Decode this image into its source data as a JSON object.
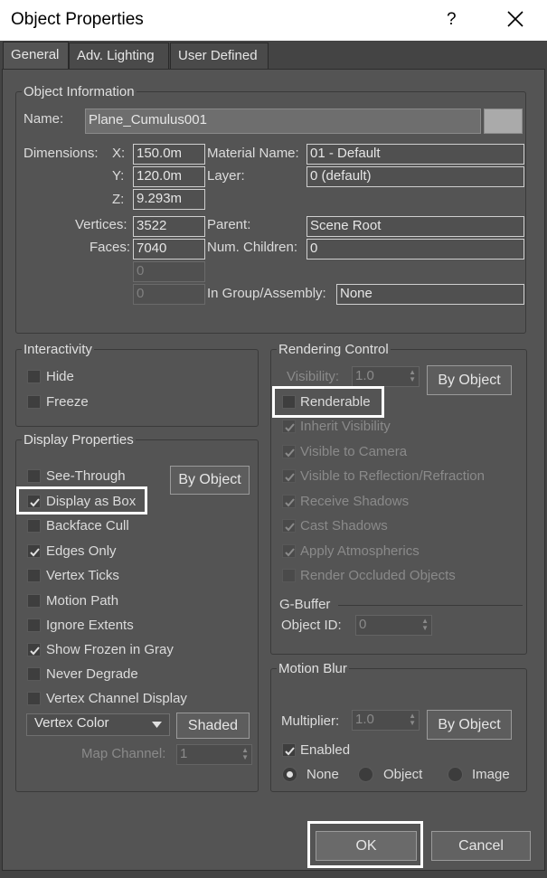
{
  "window": {
    "title": "Object Properties",
    "help": "?"
  },
  "tabs": [
    "General",
    "Adv. Lighting",
    "User Defined"
  ],
  "object_info": {
    "group": "Object Information",
    "name_label": "Name:",
    "name_value": "Plane_Cumulus001",
    "dimensions_label": "Dimensions:",
    "x_label": "X:",
    "x_value": "150.0m",
    "y_label": "Y:",
    "y_value": "120.0m",
    "z_label": "Z:",
    "z_value": "9.293m",
    "material_label": "Material Name:",
    "material_value": "01 - Default",
    "layer_label": "Layer:",
    "layer_value": "0 (default)",
    "vertices_label": "Vertices:",
    "vertices_value": "3522",
    "faces_label": "Faces:",
    "faces_value": "7040",
    "extra1_value": "0",
    "extra2_value": "0",
    "parent_label": "Parent:",
    "parent_value": "Scene Root",
    "children_label": "Num. Children:",
    "children_value": "0",
    "group_label": "In Group/Assembly:",
    "group_value": "None"
  },
  "interactivity": {
    "group": "Interactivity",
    "hide": "Hide",
    "freeze": "Freeze"
  },
  "display": {
    "group": "Display Properties",
    "by_object": "By Object",
    "items": [
      "See-Through",
      "Display as Box",
      "Backface Cull",
      "Edges Only",
      "Vertex Ticks",
      "Motion Path",
      "Ignore Extents",
      "Show Frozen in Gray",
      "Never Degrade",
      "Vertex Channel Display"
    ],
    "checked": [
      false,
      true,
      false,
      true,
      false,
      false,
      false,
      true,
      false,
      false
    ],
    "vertex_color": "Vertex Color",
    "shaded": "Shaded",
    "map_channel_label": "Map Channel:",
    "map_channel_value": "1"
  },
  "rendering": {
    "group": "Rendering Control",
    "visibility_label": "Visibility:",
    "visibility_value": "1.0",
    "by_object": "By Object",
    "renderable": "Renderable",
    "items": [
      "Inherit Visibility",
      "Visible to Camera",
      "Visible to Reflection/Refraction",
      "Receive Shadows",
      "Cast Shadows",
      "Apply Atmospherics",
      "Render Occluded Objects"
    ],
    "checked": [
      true,
      true,
      true,
      true,
      true,
      true,
      false
    ]
  },
  "gbuffer": {
    "group": "G-Buffer",
    "object_id_label": "Object ID:",
    "object_id_value": "0"
  },
  "motion_blur": {
    "group": "Motion Blur",
    "multiplier_label": "Multiplier:",
    "multiplier_value": "1.0",
    "by_object": "By Object",
    "enabled": "Enabled",
    "none": "None",
    "object": "Object",
    "image": "Image"
  },
  "buttons": {
    "ok": "OK",
    "cancel": "Cancel"
  },
  "colors": {
    "background": "#444444",
    "panel": "#545454",
    "highlight": "#ffffff"
  }
}
